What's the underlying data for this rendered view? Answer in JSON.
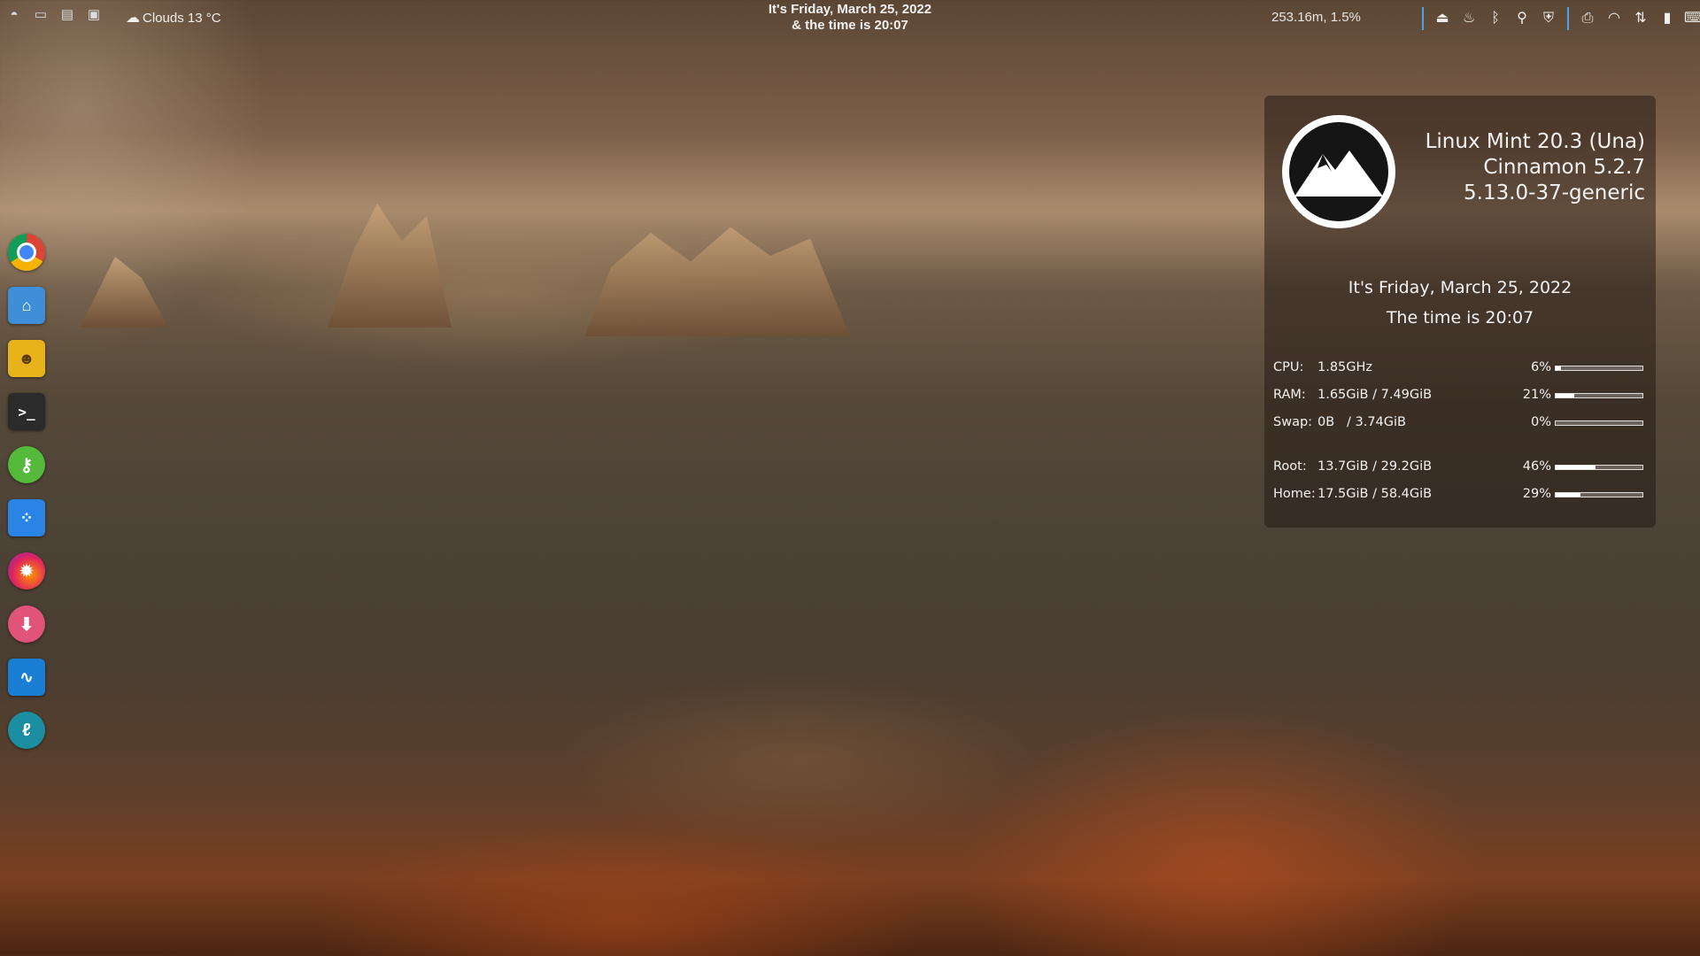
{
  "panel": {
    "launchers": [
      "mint-menu-icon",
      "folder-icon",
      "system-monitor-icon",
      "display-icon"
    ],
    "weather": "Clouds 13 °C",
    "clock_line1": "It's Friday, March 25, 2022",
    "clock_line2": "& the time is 20:07",
    "netmon": "253.16m, 1.5%"
  },
  "tray": [
    "removable-drive-icon",
    "redshift-icon",
    "bluetooth-icon",
    "location-icon",
    "shield-icon",
    "printer-icon",
    "wifi-icon",
    "network-icon",
    "battery-icon",
    "keyboard-icon",
    "workspace-icon"
  ],
  "dock": [
    {
      "name": "chrome",
      "color": "#e0e0e0"
    },
    {
      "name": "files",
      "color": "#3f8fd8"
    },
    {
      "name": "bot",
      "color": "#e8b21b"
    },
    {
      "name": "terminal",
      "color": "#2b2b2b"
    },
    {
      "name": "keys",
      "color": "#55b93b"
    },
    {
      "name": "flows",
      "color": "#2a84e6"
    },
    {
      "name": "firefox",
      "color": "#7a2bb0"
    },
    {
      "name": "download",
      "color": "#e2537a"
    },
    {
      "name": "waveform",
      "color": "#1a7fd4"
    },
    {
      "name": "feather",
      "color": "#1b8ea1"
    }
  ],
  "conky": {
    "distro": "Linux Mint 20.3 (Una)",
    "desktop": "Cinnamon 5.2.7",
    "kernel": "5.13.0-37-generic",
    "date_line": "It's Friday, March 25, 2022",
    "time_line": "The time is 20:07",
    "stats": [
      {
        "label": "CPU:",
        "value": "1.85GHz",
        "percent": "6%",
        "fraction": 0.06
      },
      {
        "label": "RAM:",
        "value": "1.65GiB / 7.49GiB",
        "percent": "21%",
        "fraction": 0.21
      },
      {
        "label": "Swap:",
        "value": "0B   / 3.74GiB",
        "percent": "0%",
        "fraction": 0.0
      }
    ],
    "disks": [
      {
        "label": "Root:",
        "value": "13.7GiB / 29.2GiB",
        "percent": "46%",
        "fraction": 0.46
      },
      {
        "label": "Home:",
        "value": "17.5GiB / 58.4GiB",
        "percent": "29%",
        "fraction": 0.29
      }
    ]
  }
}
